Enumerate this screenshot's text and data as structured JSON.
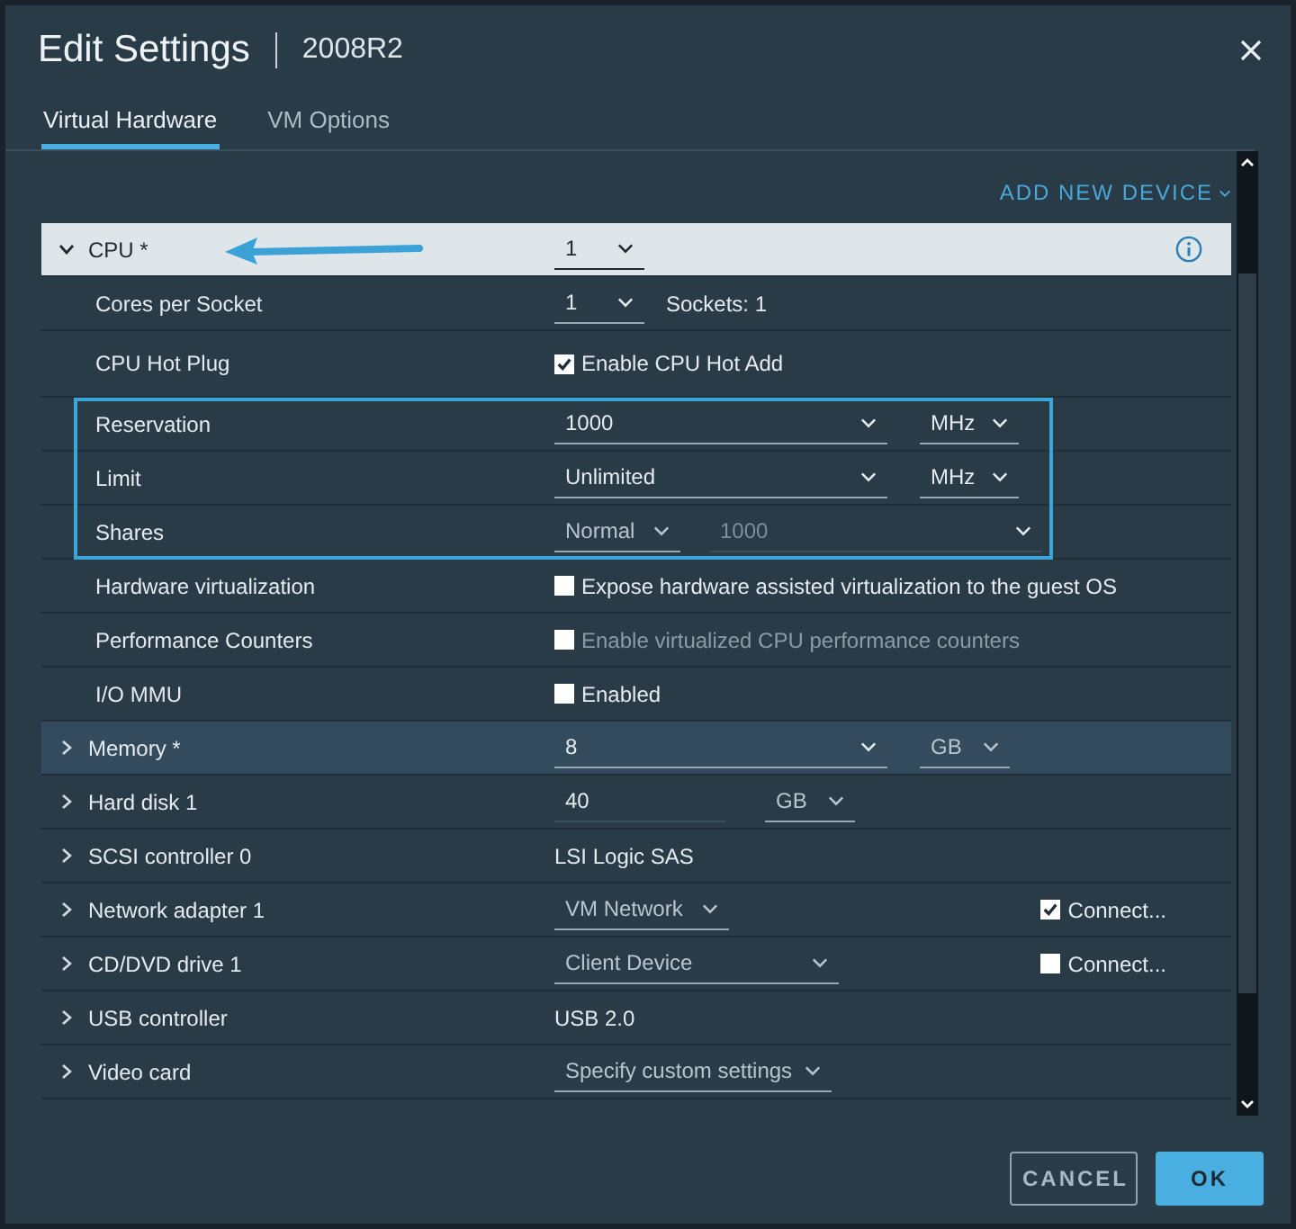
{
  "dialog": {
    "title": "Edit Settings",
    "vm_name": "2008R2"
  },
  "tabs": [
    {
      "label": "Virtual Hardware",
      "selected": true
    },
    {
      "label": "VM Options",
      "selected": false
    }
  ],
  "add_device": "ADD NEW DEVICE",
  "cpu": {
    "label": "CPU *",
    "expanded": true,
    "value": "1",
    "settings": [
      {
        "kind": "select",
        "label": "Cores per Socket",
        "value": "1",
        "note": "Sockets: 1",
        "highlighted": false
      },
      {
        "kind": "checkbox",
        "label": "CPU Hot Plug",
        "text": "Enable CPU Hot Add",
        "checked": true,
        "disabled": false,
        "highlighted": false
      },
      {
        "kind": "select_unit",
        "label": "Reservation",
        "value": "1000",
        "unit": "MHz",
        "highlighted": true
      },
      {
        "kind": "select_unit",
        "label": "Limit",
        "value": "Unlimited",
        "unit": "MHz",
        "highlighted": true
      },
      {
        "kind": "shares",
        "label": "Shares",
        "level": "Normal",
        "placeholder": "1000",
        "highlighted": true
      },
      {
        "kind": "checkbox",
        "label": "Hardware virtualization",
        "text": "Expose hardware assisted virtualization to the guest OS",
        "checked": false,
        "disabled": false,
        "highlighted": false
      },
      {
        "kind": "checkbox",
        "label": "Performance Counters",
        "text": "Enable virtualized CPU performance counters",
        "checked": false,
        "disabled": true,
        "highlighted": false
      },
      {
        "kind": "checkbox",
        "label": "I/O MMU",
        "text": "Enabled",
        "checked": false,
        "disabled": false,
        "highlighted": false
      }
    ]
  },
  "devices": [
    {
      "kind": "select_unit",
      "label": "Memory *",
      "value": "8",
      "unit": "GB",
      "expanded": false,
      "selected": true
    },
    {
      "kind": "input_unit",
      "label": "Hard disk 1",
      "value": "40",
      "unit": "GB",
      "expanded": false,
      "selected": false
    },
    {
      "kind": "text",
      "label": "SCSI controller 0",
      "value": "LSI Logic SAS",
      "expanded": false,
      "selected": false
    },
    {
      "kind": "select_connect",
      "label": "Network adapter 1",
      "value": "VM Network",
      "connect": "Connect...",
      "checked": true,
      "expanded": false,
      "selected": false
    },
    {
      "kind": "select_connect",
      "label": "CD/DVD drive 1",
      "value": "Client Device",
      "connect": "Connect...",
      "checked": false,
      "expanded": false,
      "selected": false
    },
    {
      "kind": "text",
      "label": "USB controller",
      "value": "USB 2.0",
      "expanded": false,
      "selected": false
    },
    {
      "kind": "select",
      "label": "Video card",
      "value": "Specify custom settings",
      "expanded": false,
      "selected": false
    }
  ],
  "buttons": [
    {
      "label": "CANCEL",
      "kind": "secondary"
    },
    {
      "label": "OK",
      "kind": "primary"
    }
  ]
}
